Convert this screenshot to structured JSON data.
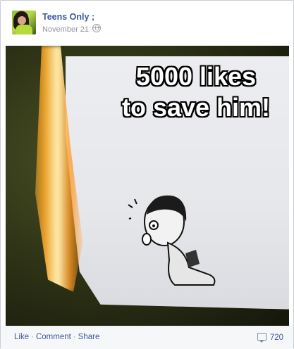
{
  "post": {
    "author": "Teens Only ;",
    "date": "November 21",
    "privacy_icon": "globe-icon",
    "image": {
      "caption_line1": "5000 likes",
      "caption_line2": "to save him!"
    }
  },
  "footer": {
    "like_label": "Like",
    "comment_label": "Comment",
    "share_label": "Share",
    "separator": "·",
    "comment_count": "720",
    "count_icon": "comment-bubble-icon"
  }
}
